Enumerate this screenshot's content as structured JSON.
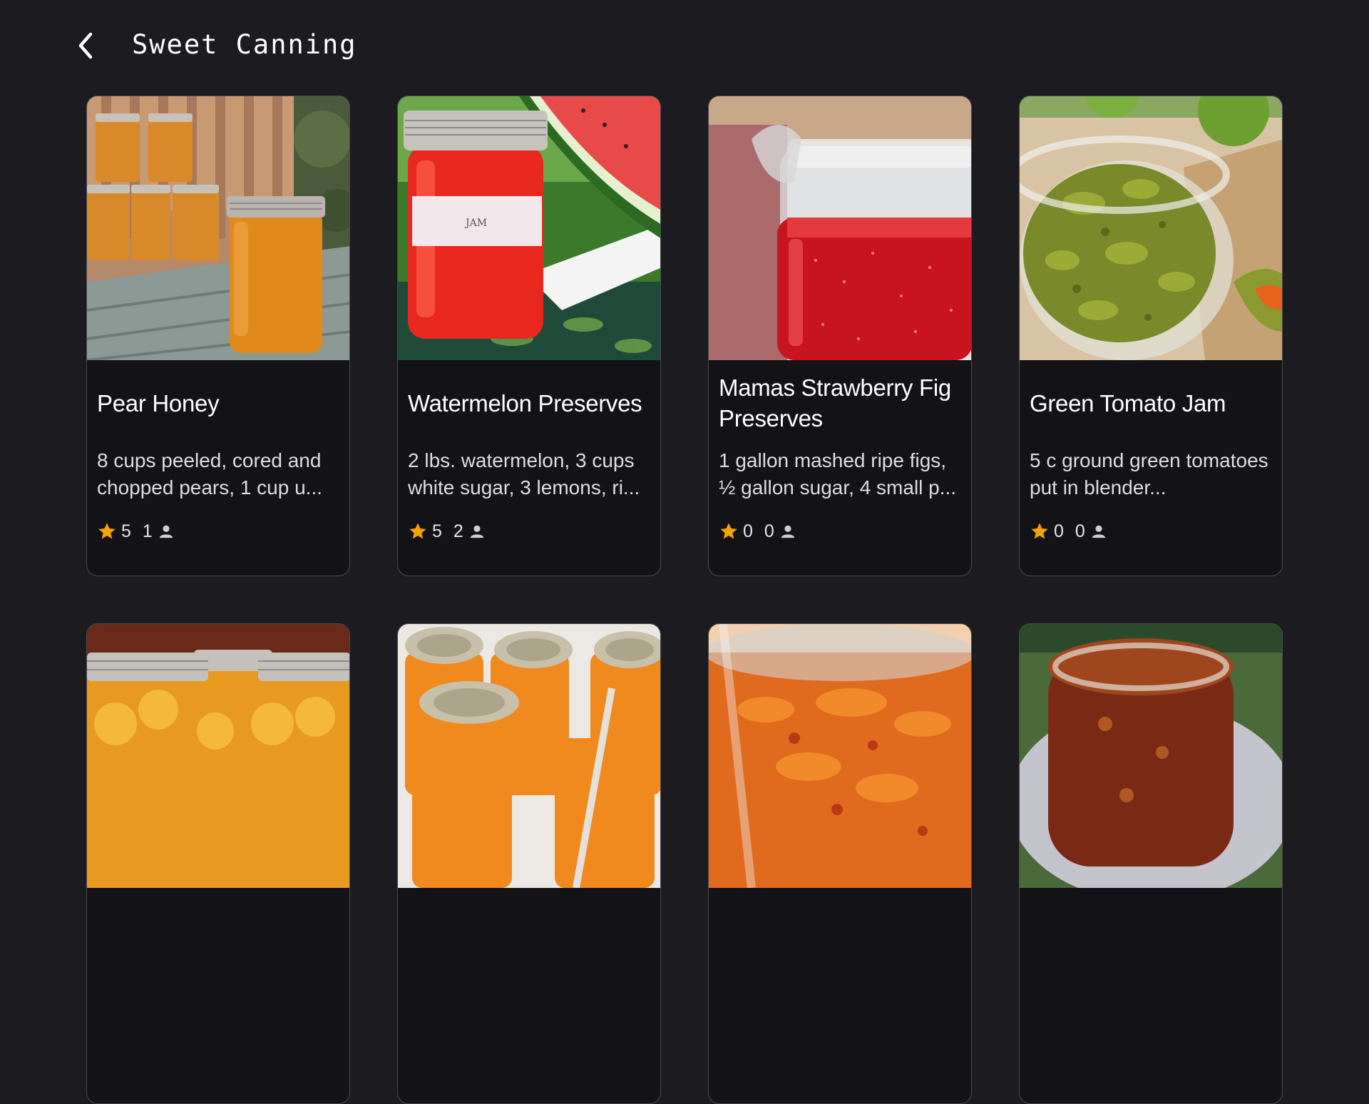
{
  "header": {
    "title": "Sweet Canning",
    "back_icon": "chevron-left-icon"
  },
  "colors": {
    "background": "#1c1b20",
    "card": "#121217",
    "star": "#f5a300"
  },
  "recipes": [
    {
      "title": "Pear Honey",
      "description": "8 cups peeled, cored and chopped pears, 1 cup u...",
      "rating": "5",
      "reviews": "1",
      "image": "jars-of-pear-honey-on-table"
    },
    {
      "title": "Watermelon Preserves",
      "description": "2 lbs. watermelon, 3 cups white sugar, 3 lemons, ri...",
      "rating": "5",
      "reviews": "2",
      "image": "watermelon-jam-jar-with-slices"
    },
    {
      "title": "Mamas Strawberry Fig Preserves",
      "description": "1 gallon mashed ripe figs, ½ gallon sugar, 4 small p...",
      "rating": "0",
      "reviews": "0",
      "image": "strawberry-fig-jam-glass-jar"
    },
    {
      "title": "Green Tomato Jam",
      "description": "5 c ground green tomatoes put in blender...",
      "rating": "0",
      "reviews": "0",
      "image": "green-tomato-jam-open-jar"
    },
    {
      "image": "canned-peaches-jars"
    },
    {
      "image": "orange-marmalade-jars"
    },
    {
      "image": "orange-jam-glass-jar"
    },
    {
      "image": "amber-jam-jar-on-plate"
    }
  ]
}
